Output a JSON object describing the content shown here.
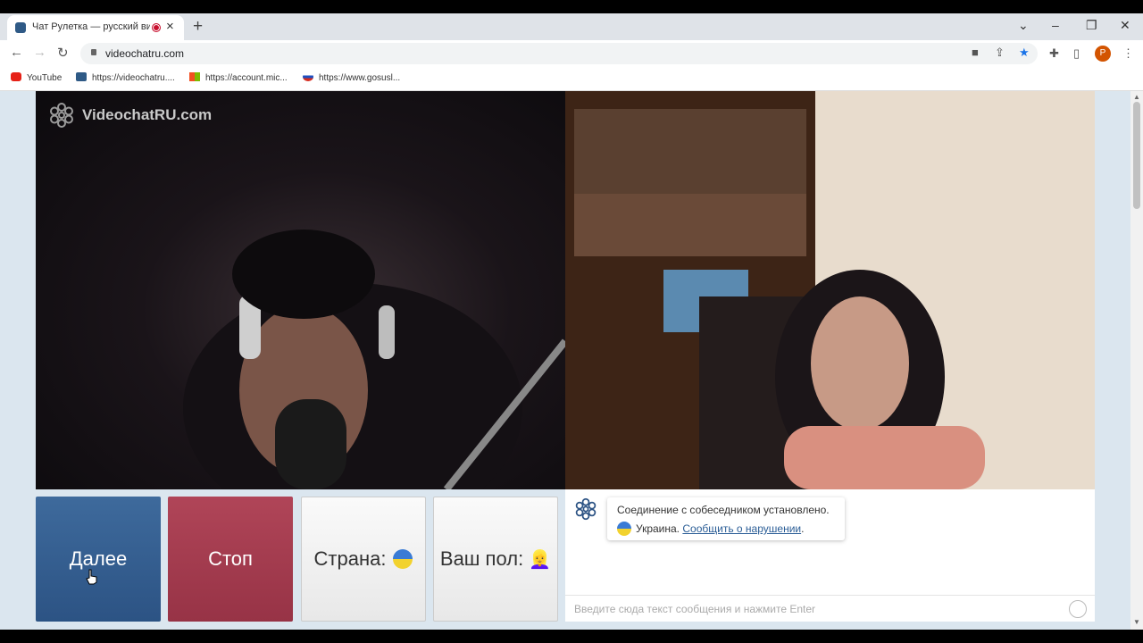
{
  "browser": {
    "tab_title": "Чат Рулетка — русский вид",
    "url": "videochatru.com",
    "bookmarks": [
      {
        "label": "YouTube"
      },
      {
        "label": "https://videochatru...."
      },
      {
        "label": "https://account.mic..."
      },
      {
        "label": "https://www.gosusl..."
      }
    ],
    "profile_initial": "P"
  },
  "app": {
    "logo_text": "VideochatRU.com",
    "buttons": {
      "next": "Далее",
      "stop": "Стоп",
      "country": "Страна:",
      "gender": "Ваш пол:"
    },
    "gender_emoji": "👱‍♀️",
    "chat": {
      "status": "Соединение с собеседником установлено.",
      "country": "Украина.",
      "report_link": "Сообщить о нарушении",
      "period": ".",
      "input_placeholder": "Введите сюда текст сообщения и нажмите Enter"
    }
  },
  "colors": {
    "next_button": "#2c5384",
    "stop_button": "#973346",
    "page_bg": "#dbe6ef"
  }
}
